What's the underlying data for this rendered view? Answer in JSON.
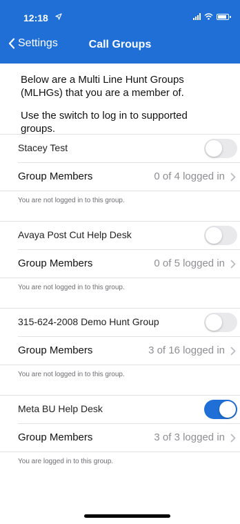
{
  "status_bar": {
    "time": "12:18"
  },
  "nav": {
    "back_label": "Settings",
    "title": "Call Groups"
  },
  "intro": {
    "line1": "Below are a Multi Line Hunt Groups (MLHGs) that you are a member of.",
    "line2": "Use the switch to log in to supported groups."
  },
  "groups": [
    {
      "name": "Stacey Test",
      "switch_on": false,
      "members_label": "Group Members",
      "members_count": "0 of 4 logged in",
      "status": "You are not logged in to this group."
    },
    {
      "name": "Avaya Post Cut Help Desk",
      "switch_on": false,
      "members_label": "Group Members",
      "members_count": "0 of 5 logged in",
      "status": "You are not logged in to this group."
    },
    {
      "name": "315-624-2008 Demo Hunt Group",
      "switch_on": false,
      "members_label": "Group Members",
      "members_count": "3 of 16 logged in",
      "status": "You are not logged in to this group."
    },
    {
      "name": "Meta BU Help Desk",
      "switch_on": true,
      "members_label": "Group Members",
      "members_count": "3 of 3 logged in",
      "status": "You are logged in to this group."
    }
  ],
  "colors": {
    "accent": "#1f6fd6",
    "toggle_off": "#e9e9ec",
    "secondary_text": "#8e8e93"
  },
  "icons": [
    "location-arrow-icon",
    "signal-icon",
    "wifi-icon",
    "battery-icon",
    "chevron-left-icon",
    "chevron-right-icon"
  ]
}
